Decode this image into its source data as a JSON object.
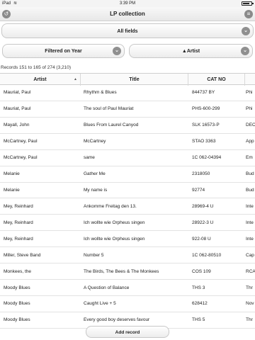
{
  "statusbar": {
    "carrier": "iPad",
    "time": "3:39 PM",
    "battery_level": 0.85
  },
  "navbar": {
    "title": "LP collection"
  },
  "search": {
    "field_label": "All fields"
  },
  "filter": {
    "label": "Filtered on Year"
  },
  "sort": {
    "label": "▲Artist"
  },
  "records_info": "Records 151 to 165 of 274 (3,210)",
  "table": {
    "headers": {
      "artist": "Artist",
      "title": "Title",
      "cat_no": "CAT NO"
    },
    "rows": [
      {
        "artist": "Mauriat, Paul",
        "title": "Rhythm & Blues",
        "cat_no": "844737 BY",
        "more": "Phi"
      },
      {
        "artist": "Mauriat, Paul",
        "title": "The soul of Paul Mauriat",
        "cat_no": "PHS-600-299",
        "more": "Phi"
      },
      {
        "artist": "Mayall, John",
        "title": "Blues From Laurel Canyod",
        "cat_no": "SLK 16573-P",
        "more": "DEC"
      },
      {
        "artist": "McCartney, Paul",
        "title": "McCartney",
        "cat_no": "STAO 3363",
        "more": "App"
      },
      {
        "artist": "McCartney, Paul",
        "title": "same",
        "cat_no": "1C 062-04394",
        "more": "Em"
      },
      {
        "artist": "Melanie",
        "title": "Gather Me",
        "cat_no": "2318050",
        "more": "Bud"
      },
      {
        "artist": "Melanie",
        "title": "My name is",
        "cat_no": "92774",
        "more": "Bud"
      },
      {
        "artist": "Mey, Reinhard",
        "title": "Ankomme Freitag den 13.",
        "cat_no": "28969-4 U",
        "more": "Inte"
      },
      {
        "artist": "Mey, Reinhard",
        "title": "Ich wollte wie Orpheus singen",
        "cat_no": "28922-3 U",
        "more": "Inte"
      },
      {
        "artist": "Mey, Reinhard",
        "title": "Ich wollte wie Orpheus singen",
        "cat_no": "922-08 U",
        "more": "Inte"
      },
      {
        "artist": "Miller, Steve Band",
        "title": "Number 5",
        "cat_no": "1C 062-80510",
        "more": "Cap"
      },
      {
        "artist": "Monkees, the",
        "title": "The Birds, The Bees & The Monkees",
        "cat_no": "COS 109",
        "more": "RCA"
      },
      {
        "artist": "Moody Blues",
        "title": "A Question of Balance",
        "cat_no": "THS 3",
        "more": "Thr"
      },
      {
        "artist": "Moody Blues",
        "title": "Caught Live + 5",
        "cat_no": "628412",
        "more": "Nov"
      },
      {
        "artist": "Moody Blues",
        "title": "Every good boy deserves favour",
        "cat_no": "THS 5",
        "more": "Thr"
      }
    ]
  },
  "add_record_label": "Add record",
  "icons": {
    "back": "back-arrow-icon",
    "menu": "menu-icon",
    "chevron": "chevron-down-icon"
  }
}
